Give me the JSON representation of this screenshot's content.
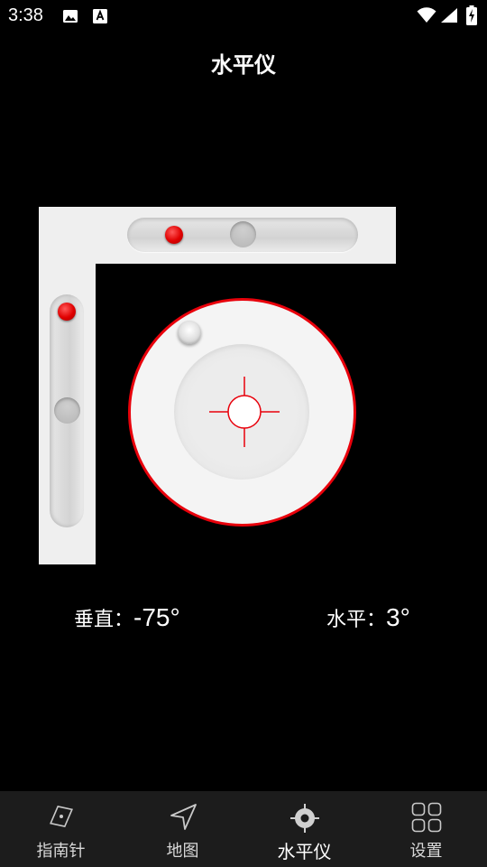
{
  "status_bar": {
    "time": "3:38",
    "icons": [
      "image-icon",
      "a-notification-icon",
      "wifi-icon",
      "signal-icon",
      "battery-charging-icon"
    ]
  },
  "header": {
    "title": "水平仪"
  },
  "level": {
    "vertical_label": "垂直：",
    "vertical_value": "-75°",
    "horizontal_label": "水平：",
    "horizontal_value": "3°",
    "accent_color": "#e8000b"
  },
  "bottom_nav": {
    "items": [
      {
        "label": "指南针",
        "icon": "compass-icon",
        "active": false
      },
      {
        "label": "地图",
        "icon": "navigation-arrow-icon",
        "active": false
      },
      {
        "label": "水平仪",
        "icon": "level-target-icon",
        "active": true
      },
      {
        "label": "设置",
        "icon": "grid-settings-icon",
        "active": false
      }
    ]
  }
}
